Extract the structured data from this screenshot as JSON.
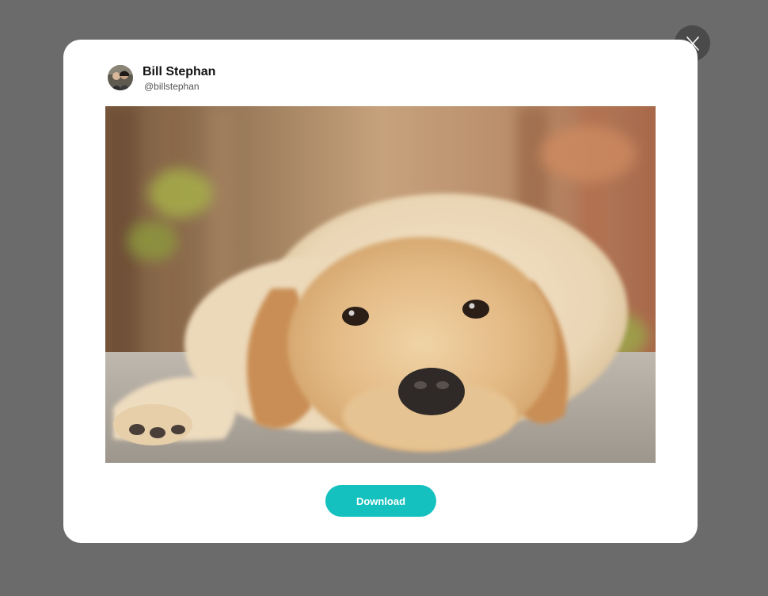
{
  "modal": {
    "author": {
      "name": "Bill Stephan",
      "handle": "@billstephan",
      "avatar_icon": "user-avatar-photo"
    },
    "image": {
      "subject_icon": "golden-retriever-puppy-photo"
    },
    "download_label": "Download",
    "close_icon": "close-x-icon"
  },
  "colors": {
    "backdrop": "#6b6b6b",
    "modal_bg": "#ffffff",
    "accent": "#14c1be",
    "close_bg": "#4a4a4a"
  }
}
